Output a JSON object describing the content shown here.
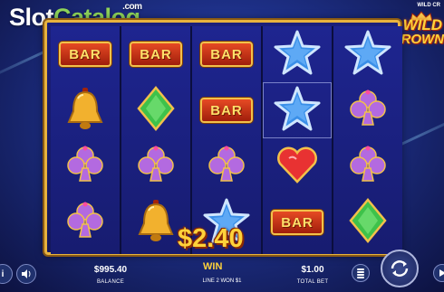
{
  "watermark": {
    "part1": "Slot",
    "part2": "Catalog",
    "suffix": ".com"
  },
  "logo": {
    "small_text": "WILD CR",
    "word1": "WILD",
    "word2": "CROWN"
  },
  "reels": [
    [
      "bar",
      "bell",
      "club",
      "club"
    ],
    [
      "bar",
      "diamond",
      "club",
      "bell"
    ],
    [
      "bar",
      "bar",
      "club",
      "star"
    ],
    [
      "star",
      "star",
      "heart",
      "bar"
    ],
    [
      "star",
      "club",
      "club",
      "diamond"
    ]
  ],
  "symbols": {
    "bar_label": "BAR"
  },
  "win": {
    "amount": "$2.40",
    "word": "WIN",
    "line_text": "LINE 2 WON $1"
  },
  "balance": {
    "value": "$995.40",
    "label": "BALANCE"
  },
  "total_bet": {
    "value": "$1.00",
    "label": "TOTAL BET"
  },
  "colors": {
    "gold": "#e8b33e",
    "star": "#3a8fe8",
    "club": "#b36ae0",
    "diamond": "#3ec24a",
    "heart": "#e83232",
    "bell": "#f2b12e"
  },
  "icons": [
    "info-icon",
    "sound-icon",
    "coin-stack-icon",
    "spin-icon",
    "autoplay-icon"
  ]
}
